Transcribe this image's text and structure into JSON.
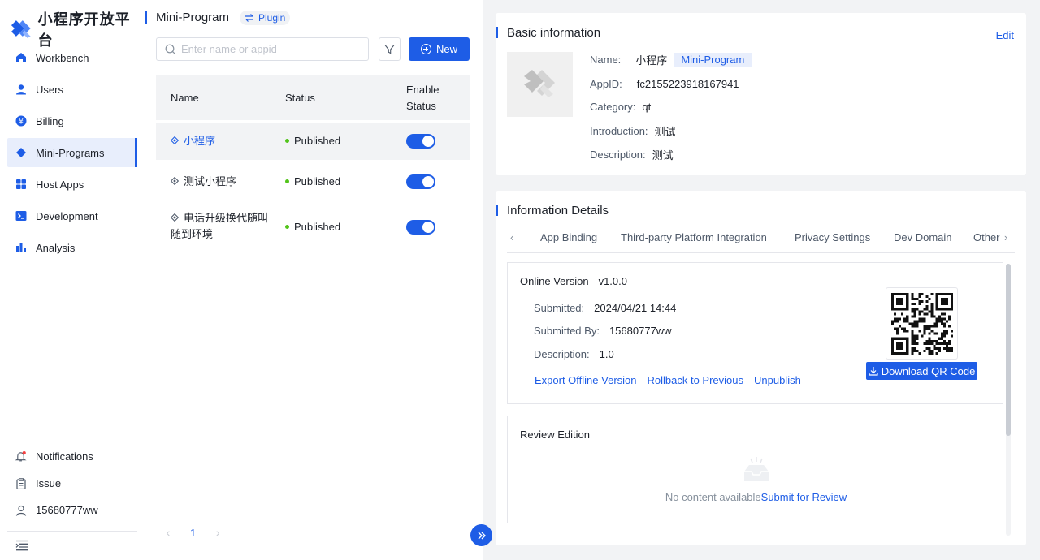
{
  "app": {
    "title": "小程序开放平台",
    "brand_color": "#1e5de6"
  },
  "sidebar": {
    "items": [
      {
        "label": "Workbench",
        "icon": "home-icon"
      },
      {
        "label": "Users",
        "icon": "user-icon"
      },
      {
        "label": "Billing",
        "icon": "billing-icon"
      },
      {
        "label": "Mini-Programs",
        "icon": "diamond-icon",
        "active": true
      },
      {
        "label": "Host Apps",
        "icon": "grid-icon"
      },
      {
        "label": "Development",
        "icon": "terminal-icon"
      },
      {
        "label": "Analysis",
        "icon": "bar-chart-icon"
      }
    ],
    "bottom": {
      "notifications": "Notifications",
      "issue": "Issue",
      "user": "15680777ww"
    }
  },
  "list_panel": {
    "title": "Mini-Program",
    "plugin_label": "Plugin",
    "search_placeholder": "Enter name or appid",
    "new_label": "New",
    "columns": {
      "name": "Name",
      "status": "Status",
      "enable_line1": "Enable",
      "enable_line2": "Status"
    },
    "rows": [
      {
        "name": "小程序",
        "status": "Published",
        "enabled": true,
        "selected": true
      },
      {
        "name": "测试小程序",
        "status": "Published",
        "enabled": true
      },
      {
        "name_line1": "电话升级换代随叫",
        "name_line2": "随到环境",
        "status": "Published",
        "enabled": true
      }
    ],
    "pagination": {
      "current": "1"
    }
  },
  "basic_info": {
    "title": "Basic information",
    "edit_label": "Edit",
    "name_label": "Name:",
    "name_value": "小程序",
    "type_tag": "Mini-Program",
    "appid_label": "AppID:",
    "appid_value": "fc2155223918167941",
    "category_label": "Category:",
    "category_value": "qt",
    "intro_label": "Introduction:",
    "intro_value": "测试",
    "desc_label": "Description:",
    "desc_value": "测试"
  },
  "details": {
    "title": "Information Details",
    "tabs": [
      "App Binding",
      "Third-party Platform Integration",
      "Privacy Settings",
      "Dev Domain",
      "Other"
    ],
    "online_version": {
      "title": "Online Version",
      "version": "v1.0.0",
      "submitted_label": "Submitted:",
      "submitted_value": "2024/04/21 14:44",
      "submitted_by_label": "Submitted By:",
      "submitted_by_value": "15680777ww",
      "description_label": "Description:",
      "description_value": "1.0",
      "actions": [
        "Export Offline Version",
        "Rollback to Previous",
        "Unpublish"
      ],
      "download_qr_label": "Download QR Code"
    },
    "review_edition": {
      "title": "Review Edition",
      "empty_text": "No content available",
      "submit_label": "Submit for Review"
    }
  }
}
